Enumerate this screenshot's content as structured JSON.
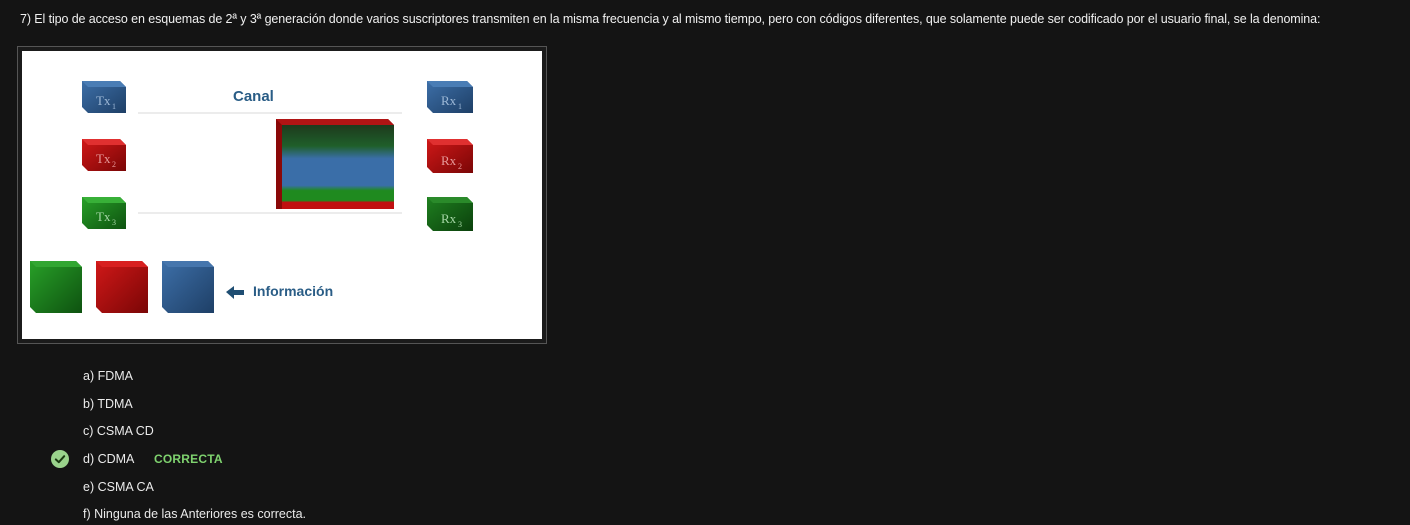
{
  "question": {
    "text": "7) El tipo de acceso en esquemas de 2ª y 3ª generación donde varios suscriptores transmiten en la misma frecuencia y al mismo tiempo, pero con códigos diferentes, que solamente puede ser codificado por el usuario final, se la denomina:"
  },
  "figure": {
    "canal_label": "Canal",
    "info_label": "Información",
    "tx": [
      {
        "base": "Tx",
        "sub": "1",
        "color": "#2f5f94"
      },
      {
        "base": "Tx",
        "sub": "2",
        "color": "#b31010"
      },
      {
        "base": "Tx",
        "sub": "3",
        "color": "#1f8a1f"
      }
    ],
    "rx": [
      {
        "base": "Rx",
        "sub": "1",
        "color": "#2f5f94"
      },
      {
        "base": "Rx",
        "sub": "2",
        "color": "#b31010"
      },
      {
        "base": "Rx",
        "sub": "3",
        "color": "#1f6b1f"
      }
    ],
    "colors": {
      "blue": "#2f5f94",
      "red": "#b31010",
      "green": "#1f8a1f",
      "label": "#2a5d86"
    }
  },
  "options": [
    {
      "label": "a) FDMA"
    },
    {
      "label": "b) TDMA"
    },
    {
      "label": "c) CSMA CD"
    },
    {
      "label": "d) CDMA",
      "badge": "CORRECTA",
      "correct": true
    },
    {
      "label": "e) CSMA CA"
    },
    {
      "label": "f) Ninguna de las Anteriores es correcta."
    }
  ],
  "icons": {
    "correct": "check-circle-icon"
  }
}
